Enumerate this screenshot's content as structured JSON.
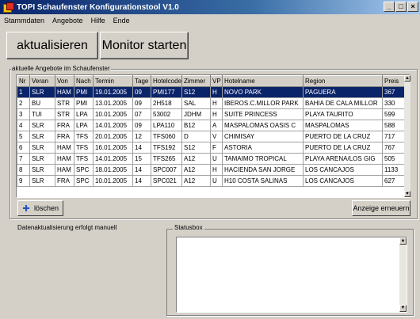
{
  "window": {
    "title": "TOPI Schaufenster Konfigurationstool V1.0",
    "minimize": "_",
    "maximize": "□",
    "close": "×"
  },
  "menu": [
    "Stammdaten",
    "Angebote",
    "Hilfe",
    "Ende"
  ],
  "toolbar": {
    "refresh_label": "aktualisieren",
    "monitor_label": "Monitor starten"
  },
  "offers": {
    "group_label": "aktuelle Angebote im Schaufenster",
    "columns": [
      "Nr",
      "Veran",
      "Von",
      "Nach",
      "Termin",
      "Tage",
      "Hotelcode",
      "Zimmer",
      "VP",
      "Hotelname",
      "Region",
      "Preis"
    ],
    "rows": [
      [
        "1",
        "SLR",
        "HAM",
        "PMI",
        "19.01.2005",
        "09",
        "PMI177",
        "S12",
        "H",
        "NOVO PARK",
        "PAGUERA",
        "367"
      ],
      [
        "2",
        "BU",
        "STR",
        "PMI",
        "13.01.2005",
        "09",
        "2H518",
        "SAL",
        "H",
        "IBEROS.C.MILLOR PARK",
        "BAHIA DE CALA MILLOR",
        "330"
      ],
      [
        "3",
        "TUI",
        "STR",
        "LPA",
        "10.01.2005",
        "07",
        "53002",
        "JDHM",
        "H",
        "SUITE PRINCESS",
        "PLAYA TAURITO",
        "599"
      ],
      [
        "4",
        "SLR",
        "FRA",
        "LPA",
        "14.01.2005",
        "09",
        "LPA110",
        "B12",
        "A",
        "MASPALOMAS OASIS C",
        "MASPALOMAS",
        "588"
      ],
      [
        "5",
        "SLR",
        "FRA",
        "TFS",
        "20.01.2005",
        "12",
        "TFS060",
        "D",
        "V",
        "CHIMISAY",
        "PUERTO DE LA CRUZ",
        "717"
      ],
      [
        "6",
        "SLR",
        "HAM",
        "TFS",
        "16.01.2005",
        "14",
        "TFS192",
        "S12",
        "F",
        "ASTORIA",
        "PUERTO DE LA CRUZ",
        "767"
      ],
      [
        "7",
        "SLR",
        "HAM",
        "TFS",
        "14.01.2005",
        "15",
        "TFS265",
        "A12",
        "U",
        "TAMAIMO TROPICAL",
        "PLAYA ARENA/LOS GIG",
        "505"
      ],
      [
        "8",
        "SLR",
        "HAM",
        "SPC",
        "18.01.2005",
        "14",
        "SPC007",
        "A12",
        "H",
        "HACIENDA SAN JORGE",
        "LOS CANCAJOS",
        "1133"
      ],
      [
        "9",
        "SLR",
        "FRA",
        "SPC",
        "10.01.2005",
        "14",
        "SPC021",
        "A12",
        "U",
        "H10 COSTA SALINAS",
        "LOS CANCAJOS",
        "627"
      ]
    ],
    "delete_label": "löschen",
    "refresh_view_label": "Anzeige erneuern"
  },
  "status": {
    "message": "Datenaktualisierung erfolgt manuell",
    "box_label": "Statusbox"
  }
}
